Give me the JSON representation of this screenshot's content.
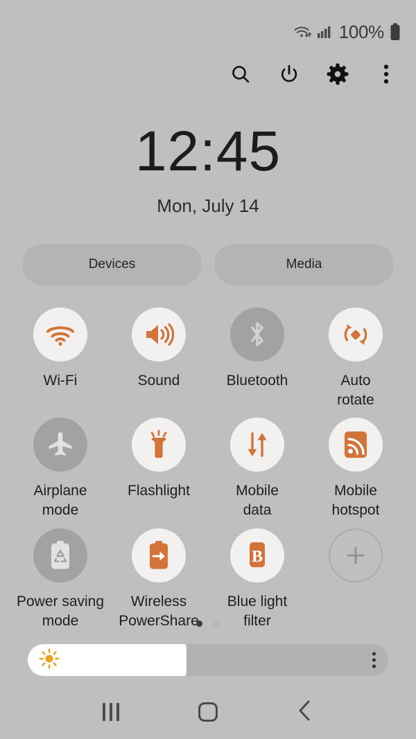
{
  "statusbar": {
    "wifi_icon": "wifi-data-icon",
    "signal_icon": "cellular-signal-icon",
    "battery_percent": "100%",
    "battery_icon": "battery-full-icon"
  },
  "header": {
    "icons": [
      {
        "name": "search-icon",
        "label": "Search"
      },
      {
        "name": "power-icon",
        "label": "Power"
      },
      {
        "name": "gear-icon",
        "label": "Settings"
      },
      {
        "name": "more-vertical-icon",
        "label": "More options"
      }
    ]
  },
  "clock": {
    "time": "12:45",
    "date": "Mon, July 14"
  },
  "pills": [
    {
      "label": "Devices",
      "name": "devices-button"
    },
    {
      "label": "Media",
      "name": "media-button"
    }
  ],
  "tiles": [
    {
      "label": "Wi-Fi",
      "icon": "wifi-icon",
      "state": "on"
    },
    {
      "label": "Sound",
      "icon": "sound-icon",
      "state": "on"
    },
    {
      "label": "Bluetooth",
      "icon": "bluetooth-icon",
      "state": "off"
    },
    {
      "label": "Auto\nrotate",
      "icon": "auto-rotate-icon",
      "state": "on"
    },
    {
      "label": "Airplane\nmode",
      "icon": "airplane-icon",
      "state": "off"
    },
    {
      "label": "Flashlight",
      "icon": "flashlight-icon",
      "state": "on"
    },
    {
      "label": "Mobile\ndata",
      "icon": "mobile-data-icon",
      "state": "on"
    },
    {
      "label": "Mobile\nhotspot",
      "icon": "mobile-hotspot-icon",
      "state": "on"
    },
    {
      "label": "Power saving\nmode",
      "icon": "power-saving-icon",
      "state": "off"
    },
    {
      "label": "Wireless\nPowerShare",
      "icon": "wireless-powershare-icon",
      "state": "on"
    },
    {
      "label": "Blue light\nfilter",
      "icon": "blue-light-filter-icon",
      "state": "on"
    },
    {
      "label": "",
      "icon": "plus-icon",
      "state": "add"
    }
  ],
  "page_dots": {
    "total": 2,
    "active_index": 0
  },
  "brightness": {
    "icon": "brightness-sun-icon",
    "value_percent": 44,
    "menu_icon": "more-vertical-icon"
  },
  "navbar": [
    {
      "name": "recents-button",
      "icon": "recents-icon",
      "label": "Recents"
    },
    {
      "name": "home-button",
      "icon": "home-icon",
      "label": "Home"
    },
    {
      "name": "back-button",
      "icon": "back-icon",
      "label": "Back"
    }
  ],
  "colors": {
    "background": "#bfbfbf",
    "accent_orange": "#d2743a",
    "tile_on": "#f3f1ef",
    "tile_off": "#a2a2a2",
    "slider_fill": "#ffffff",
    "sun_yellow": "#e8a317"
  }
}
